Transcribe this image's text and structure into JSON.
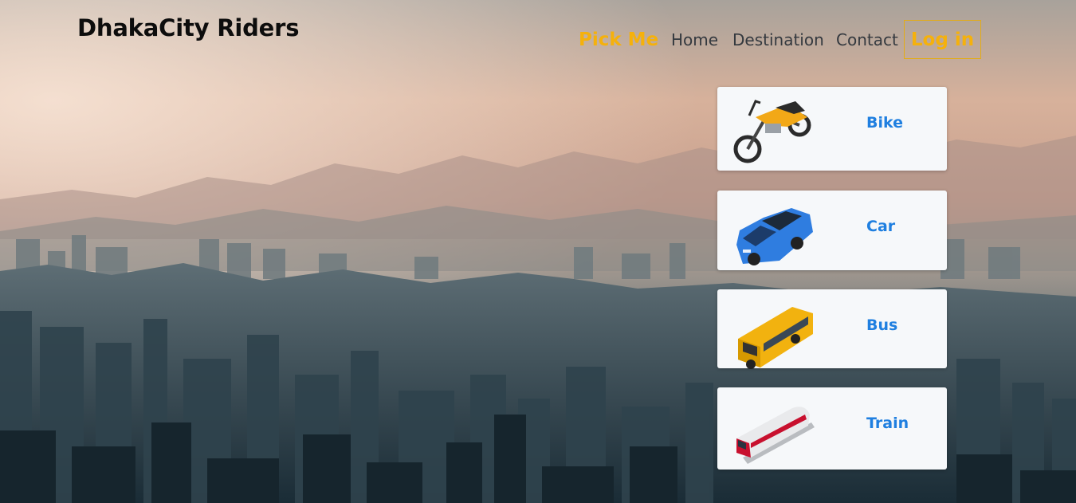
{
  "header": {
    "brand": "DhakaCity Riders"
  },
  "nav": {
    "pick_me": "Pick Me",
    "links": [
      "Home",
      "Destination",
      "Contact"
    ],
    "login": "Log in"
  },
  "vehicles": [
    {
      "label": "Bike",
      "icon": "motorbike-icon"
    },
    {
      "label": "Car",
      "icon": "car-icon"
    },
    {
      "label": "Bus",
      "icon": "bus-icon"
    },
    {
      "label": "Train",
      "icon": "train-icon"
    }
  ],
  "colors": {
    "accent": "#f5b10c",
    "link_blue": "#1f7fe0",
    "card_bg": "#f6f8fa"
  }
}
